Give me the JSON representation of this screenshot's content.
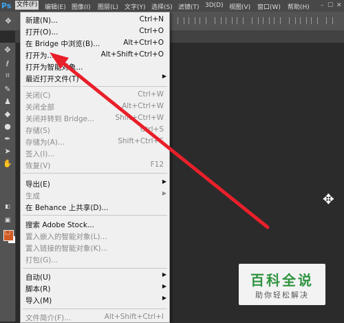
{
  "app": {
    "logo": "Ps"
  },
  "menubar": {
    "items": [
      "文件(F)",
      "编辑(E)",
      "图像(I)",
      "图层(L)",
      "文字(Y)",
      "选择(S)",
      "滤镜(T)",
      "3D(D)",
      "视图(V)",
      "窗口(W)",
      "帮助(H)"
    ],
    "window_controls": [
      "–",
      "☐",
      "✕"
    ]
  },
  "file_menu": {
    "items": [
      {
        "label": "新建(N)...",
        "shortcut": "Ctrl+N",
        "enabled": true
      },
      {
        "label": "打开(O)...",
        "shortcut": "Ctrl+O",
        "enabled": true
      },
      {
        "label": "在 Bridge 中浏览(B)...",
        "shortcut": "Alt+Ctrl+O",
        "enabled": true
      },
      {
        "label": "打开为...",
        "shortcut": "Alt+Shift+Ctrl+O",
        "enabled": true
      },
      {
        "label": "打开为智能对象...",
        "shortcut": "",
        "enabled": true
      },
      {
        "label": "最近打开文件(T)",
        "shortcut": "",
        "enabled": true,
        "submenu": true
      },
      {
        "label": "关闭(C)",
        "shortcut": "Ctrl+W",
        "enabled": false
      },
      {
        "label": "关闭全部",
        "shortcut": "Alt+Ctrl+W",
        "enabled": false
      },
      {
        "label": "关闭并转到 Bridge...",
        "shortcut": "Shift+Ctrl+W",
        "enabled": false
      },
      {
        "label": "存储(S)",
        "shortcut": "Ctrl+S",
        "enabled": false
      },
      {
        "label": "存储为(A)...",
        "shortcut": "Shift+Ctrl+S",
        "enabled": false
      },
      {
        "label": "签入(I)...",
        "shortcut": "",
        "enabled": false
      },
      {
        "label": "恢复(V)",
        "shortcut": "F12",
        "enabled": false
      },
      {
        "label": "导出(E)",
        "shortcut": "",
        "enabled": true,
        "submenu": true
      },
      {
        "label": "生成",
        "shortcut": "",
        "enabled": false,
        "submenu": true
      },
      {
        "label": "在 Behance 上共享(D)...",
        "shortcut": "",
        "enabled": true
      },
      {
        "label": "搜索 Adobe Stock...",
        "shortcut": "",
        "enabled": true
      },
      {
        "label": "置入嵌入的智能对象(L)...",
        "shortcut": "",
        "enabled": false
      },
      {
        "label": "置入链接的智能对象(K)...",
        "shortcut": "",
        "enabled": false
      },
      {
        "label": "打包(G)...",
        "shortcut": "",
        "enabled": false
      },
      {
        "label": "自动(U)",
        "shortcut": "",
        "enabled": true,
        "submenu": true
      },
      {
        "label": "脚本(R)",
        "shortcut": "",
        "enabled": true,
        "submenu": true
      },
      {
        "label": "导入(M)",
        "shortcut": "",
        "enabled": true,
        "submenu": true
      },
      {
        "label": "文件简介(F)...",
        "shortcut": "Alt+Shift+Ctrl+I",
        "enabled": false
      }
    ]
  },
  "toolbar": {
    "tools": [
      "move-tool",
      "lasso-tool",
      "crop-tool",
      "brush-tool",
      "stamp-tool",
      "eraser-tool",
      "drop-tool",
      "pen-tool",
      "path-select-tool",
      "hand-tool"
    ],
    "foreground_color": "#d35a23",
    "background_color": "#ffffff"
  },
  "watermark": {
    "title": "百科全说",
    "subtitle": "助你轻松解决",
    "title_color": "#2f9440"
  },
  "annotation": {
    "arrow_color": "#e8202a"
  }
}
